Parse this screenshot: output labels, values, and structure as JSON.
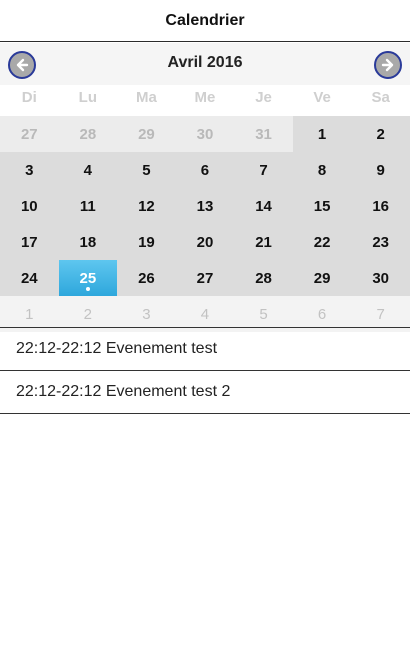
{
  "header": {
    "title": "Calendrier"
  },
  "calendar": {
    "month_title": "Avril 2016",
    "prev_icon": "arrow-left-icon",
    "next_icon": "arrow-right-icon",
    "weekdays": [
      "Di",
      "Lu",
      "Ma",
      "Me",
      "Je",
      "Ve",
      "Sa"
    ],
    "weeks": [
      [
        "27",
        "28",
        "29",
        "30",
        "31",
        "1",
        "2"
      ],
      [
        "3",
        "4",
        "5",
        "6",
        "7",
        "8",
        "9"
      ],
      [
        "10",
        "11",
        "12",
        "13",
        "14",
        "15",
        "16"
      ],
      [
        "17",
        "18",
        "19",
        "20",
        "21",
        "22",
        "23"
      ],
      [
        "24",
        "25",
        "26",
        "27",
        "28",
        "29",
        "30"
      ],
      [
        "1",
        "2",
        "3",
        "4",
        "5",
        "6",
        "7"
      ]
    ],
    "selected_day": "25",
    "accent_color": "#3fb3e6"
  },
  "events": [
    {
      "label": "22:12-22:12 Evenement test"
    },
    {
      "label": "22:12-22:12 Evenement test 2"
    }
  ]
}
